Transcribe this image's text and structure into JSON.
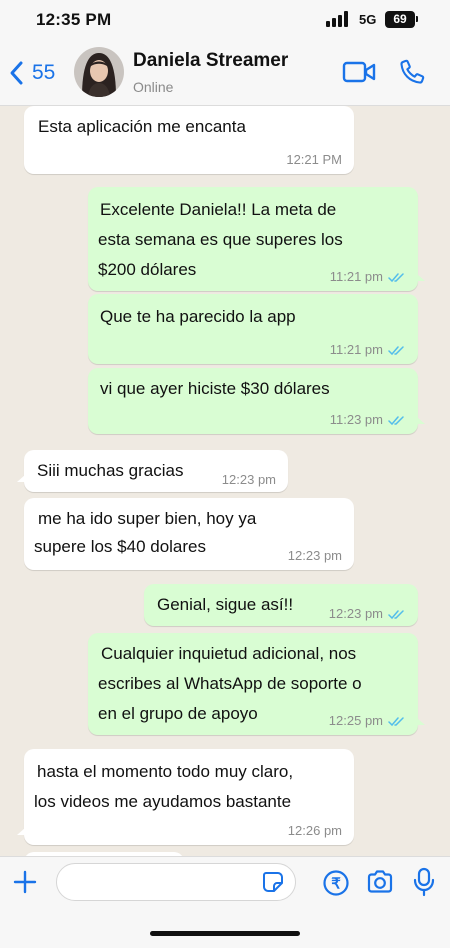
{
  "status_bar": {
    "time": "12:35 PM",
    "network": "5G",
    "battery": "69"
  },
  "header": {
    "back_count": "55",
    "contact_name": "Daniela Streamer",
    "contact_status": "Online",
    "accent_color": "#1a73e8"
  },
  "messages": [
    {
      "direction": "in",
      "lines": [
        "Esta aplicación me encanta"
      ],
      "time": "12:21 PM",
      "read": false
    },
    {
      "direction": "out",
      "lines": [
        "Excelente Daniela!! La meta de",
        "esta semana es que superes los",
        "$200 dólares"
      ],
      "time": "11:21 pm",
      "read": true
    },
    {
      "direction": "out",
      "lines": [
        "Que te ha parecido la app"
      ],
      "time": "11:21 pm",
      "read": true
    },
    {
      "direction": "out",
      "lines": [
        "vi que ayer hiciste $30 dólares"
      ],
      "time": "11:23 pm",
      "read": true
    },
    {
      "direction": "in",
      "lines": [
        "Siii muchas gracias"
      ],
      "time": "12:23 pm",
      "read": false
    },
    {
      "direction": "in",
      "lines": [
        "me ha ido super bien, hoy ya",
        "supere los $40 dolares"
      ],
      "time": "12:23 pm",
      "read": false
    },
    {
      "direction": "out",
      "lines": [
        "Genial, sigue así!!"
      ],
      "time": "12:23 pm",
      "read": true
    },
    {
      "direction": "out",
      "lines": [
        "Cualquier inquietud adicional, nos",
        "escribes al WhatsApp de soporte o",
        "en el grupo de apoyo"
      ],
      "time": "12:25 pm",
      "read": true
    },
    {
      "direction": "in",
      "lines": [
        "hasta el momento todo muy claro,",
        "los videos me ayudamos bastante"
      ],
      "time": "12:26 pm",
      "read": false
    }
  ],
  "input_bar": {
    "placeholder": "",
    "icons": [
      "plus-icon",
      "sticker-icon",
      "payment-icon",
      "camera-icon",
      "microphone-icon"
    ]
  },
  "colors": {
    "background": "#efeae2",
    "outgoing_bubble": "#d9fdd3",
    "incoming_bubble": "#ffffff",
    "read_ticks": "#53bdeb"
  }
}
